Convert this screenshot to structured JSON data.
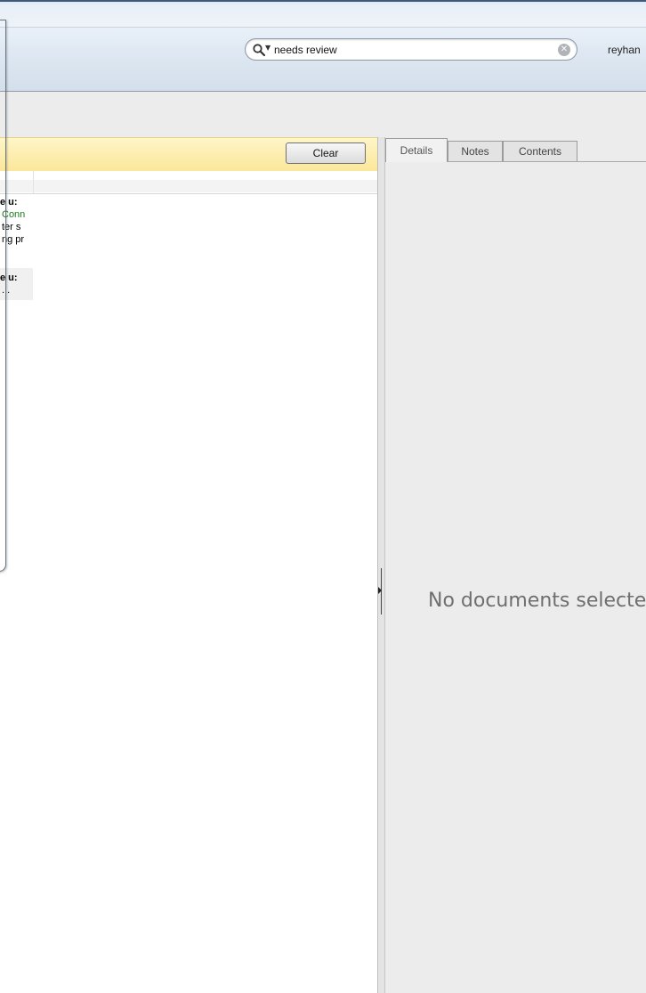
{
  "toolbar": {
    "search": {
      "value": "needs review",
      "icon": "search-icon"
    },
    "user_label": "reyhan"
  },
  "filter_bar": {
    "clear_label": "Clear",
    "bg_color": "#fbe79a"
  },
  "list": {
    "rows": [
      {
        "title": "e u:",
        "lines": [
          "Conn",
          "ter s",
          "ng pr"
        ]
      },
      {
        "title": "e u:",
        "lines": [
          "..."
        ]
      }
    ]
  },
  "details": {
    "tabs": [
      "Details",
      "Notes",
      "Contents"
    ],
    "active_tab": "Details",
    "empty_message": "No documents selecte"
  }
}
